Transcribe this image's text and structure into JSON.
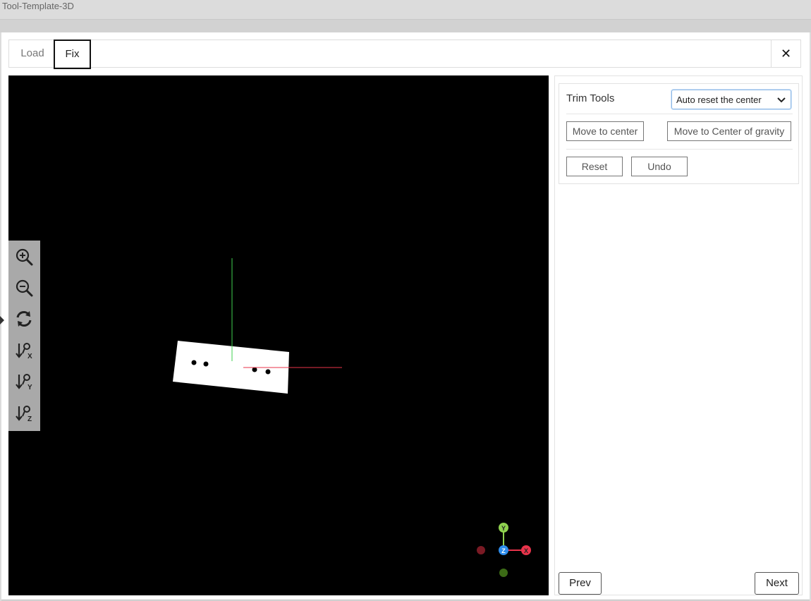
{
  "window": {
    "title": "Tool-Template-3D"
  },
  "tabs": [
    {
      "label": "Load"
    },
    {
      "label": "Fix"
    }
  ],
  "close_icon": "close-icon",
  "viewport": {
    "background": "#000000",
    "tools": [
      {
        "name": "zoom-in-icon"
      },
      {
        "name": "zoom-out-icon"
      },
      {
        "name": "refresh-icon"
      },
      {
        "name": "sort-x-icon",
        "axis": "X"
      },
      {
        "name": "sort-y-icon",
        "axis": "Y"
      },
      {
        "name": "sort-z-icon",
        "axis": "Z"
      }
    ],
    "axis_gizmo": {
      "y_label": "Y",
      "z_label": "Z",
      "x_label": "X"
    }
  },
  "trim_tools": {
    "title": "Trim Tools",
    "select_value": "Auto reset the center",
    "move_to_center": "Move to center",
    "move_to_gravity": "Move to Center of gravity",
    "reset": "Reset",
    "undo": "Undo"
  },
  "footer": {
    "prev": "Prev",
    "next": "Next"
  },
  "colors": {
    "x_axis": "#e8334a",
    "y_axis": "#8fd14f",
    "z_axis": "#2d8ceb",
    "x_axis_neg": "#7a1a24",
    "y_axis_neg": "#3c6b16",
    "tool_panel": "#a9a9a9"
  }
}
